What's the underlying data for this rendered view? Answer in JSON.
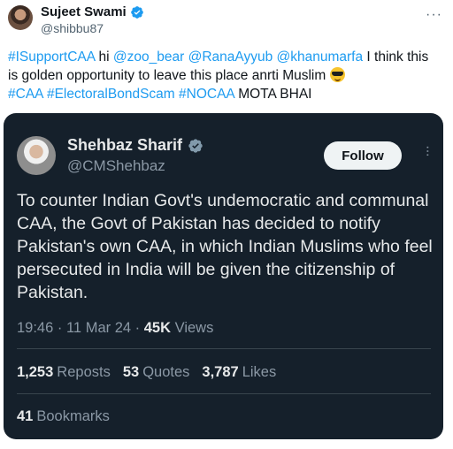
{
  "tweet": {
    "author_name": "Sujeet Swami",
    "author_handle": "@shibbu87",
    "text_tag1": "#ISupportCAA",
    "text_word1": " hi ",
    "text_mention1": "@zoo_bear",
    "text_mention2": " @RanaAyyub",
    "text_mention3": " @khanumarfa",
    "text_body": " I think this is golden opportunity to leave this place anrti Muslim ",
    "text_tag2": "#CAA",
    "text_tag3": " #ElectoralBondScam",
    "text_tag4": " #NOCAA",
    "text_tail": " MOTA BHAI",
    "emoji": "smiling-face-with-sunglasses"
  },
  "quoted": {
    "author_name": "Shehbaz Sharif",
    "author_handle": "@CMShehbaz",
    "follow_label": "Follow",
    "body": "To counter Indian Govt's undemocratic and communal CAA, the Govt of Pakistan has decided to notify Pakistan's own CAA, in which Indian Muslims who feel persecuted in India will be given the citizenship of Pakistan.",
    "time": "19:46",
    "date": "11 Mar 24",
    "views_count": "45K",
    "views_label": "Views",
    "reposts_count": "1,253",
    "reposts_label": "Reposts",
    "quotes_count": "53",
    "quotes_label": "Quotes",
    "likes_count": "3,787",
    "likes_label": "Likes",
    "bookmarks_count": "41",
    "bookmarks_label": "Bookmarks"
  },
  "colors": {
    "link": "#1d9bf0",
    "verified": "#1d9bf0",
    "card_bg": "#15202b"
  }
}
